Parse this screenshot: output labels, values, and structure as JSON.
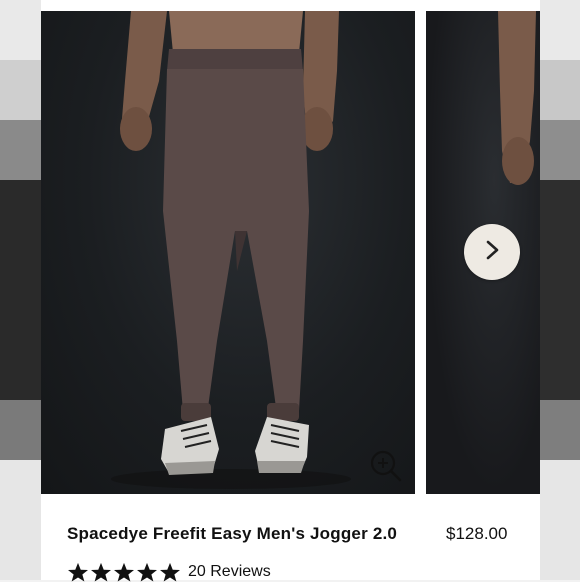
{
  "product": {
    "title": "Spacedye Freefit Easy Men's Jogger 2.0",
    "price": "$128.00",
    "rating_stars": 5,
    "reviews_label": "20 Reviews"
  },
  "gallery": {
    "zoom_icon": "zoom-in-icon",
    "next_icon": "chevron-right-icon"
  },
  "colors": {
    "photo_background": "#1b1e21",
    "pants": "#5a4a48",
    "next_button": "#eeeae3",
    "text": "#111111"
  }
}
